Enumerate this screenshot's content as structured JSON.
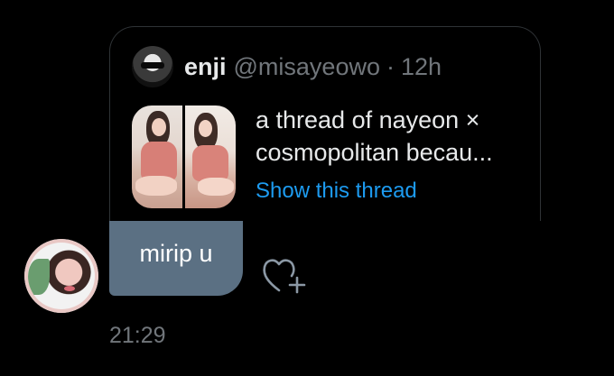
{
  "quote": {
    "author_name": "enji",
    "author_handle": "@misayeowo",
    "separator": "·",
    "time": "12h",
    "text_line_1": "a thread of nayeon ×",
    "text_line_2": "cosmopolitan becau...",
    "show_thread_label": "Show this thread",
    "link_color": "#1d9bf0"
  },
  "message": {
    "text": "mirip u",
    "timestamp": "21:29",
    "bubble_color": "#5b7083",
    "react_icon": "heart-plus-icon"
  }
}
